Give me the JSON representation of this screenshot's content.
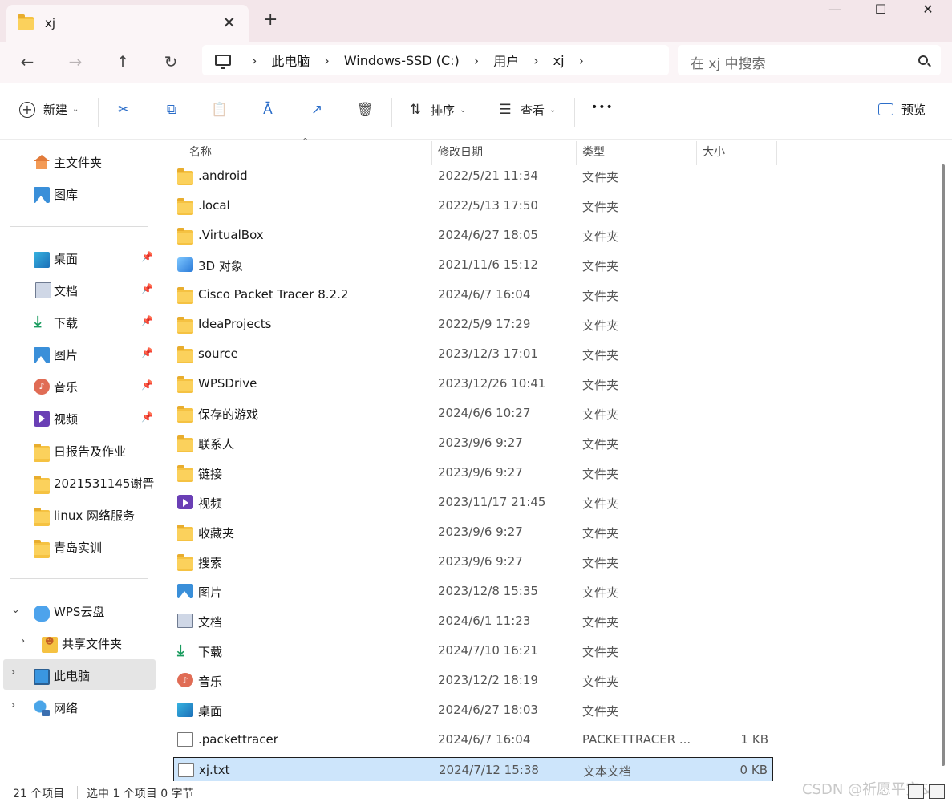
{
  "window": {
    "tab_title": "xj",
    "new_tab_glyph": "+",
    "close_tab_glyph": "✕",
    "minimize_glyph": "—",
    "maximize_glyph": "☐",
    "close_glyph": "✕"
  },
  "nav": {
    "back_glyph": "←",
    "forward_glyph": "→",
    "up_glyph": "↑",
    "refresh_glyph": "↻",
    "breadcrumb": [
      "此电脑",
      "Windows-SSD (C:)",
      "用户",
      "xj"
    ],
    "crumb_sep": "›",
    "search_placeholder": "在 xj 中搜索"
  },
  "toolbar": {
    "new_label": "新建",
    "sort_label": "排序",
    "view_label": "查看",
    "more_glyph": "•••",
    "preview_label": "预览",
    "icons": {
      "cut": "✂",
      "copy": "⧉",
      "paste": "📋",
      "rename": "Ā",
      "share": "↗",
      "delete": "🗑"
    }
  },
  "sidebar": {
    "quick": [
      {
        "label": "主文件夹",
        "icon": "home-icon"
      },
      {
        "label": "图库",
        "icon": "gallery-icon"
      }
    ],
    "pinned": [
      {
        "label": "桌面",
        "icon": "desktop-icon",
        "pinned": true
      },
      {
        "label": "文档",
        "icon": "documents-icon",
        "pinned": true
      },
      {
        "label": "下载",
        "icon": "download-icon",
        "pinned": true
      },
      {
        "label": "图片",
        "icon": "pictures-icon",
        "pinned": true
      },
      {
        "label": "音乐",
        "icon": "music-icon",
        "pinned": true
      },
      {
        "label": "视频",
        "icon": "videos-icon",
        "pinned": true
      },
      {
        "label": "日报告及作业",
        "icon": "folder-icon",
        "pinned": false
      },
      {
        "label": "2021531145谢晋",
        "icon": "folder-icon",
        "pinned": false
      },
      {
        "label": "linux 网络服务",
        "icon": "folder-icon",
        "pinned": false
      },
      {
        "label": "青岛实训",
        "icon": "folder-icon",
        "pinned": false
      }
    ],
    "tree": [
      {
        "label": "WPS云盘",
        "icon": "cloud-icon",
        "expanded": true
      },
      {
        "label": "共享文件夹",
        "icon": "shared-folder-icon"
      },
      {
        "label": "此电脑",
        "icon": "this-pc-icon",
        "selected": true
      },
      {
        "label": "网络",
        "icon": "network-icon"
      }
    ],
    "pin_glyph": "📌"
  },
  "columns": {
    "name": "名称",
    "date": "修改日期",
    "type": "类型",
    "size": "大小"
  },
  "files": [
    {
      "name": ".android",
      "date": "2022/5/21 11:34",
      "type": "文件夹",
      "size": "",
      "icon": "folder"
    },
    {
      "name": ".local",
      "date": "2022/5/13 17:50",
      "type": "文件夹",
      "size": "",
      "icon": "folder"
    },
    {
      "name": ".VirtualBox",
      "date": "2024/6/27 18:05",
      "type": "文件夹",
      "size": "",
      "icon": "folder"
    },
    {
      "name": "3D 对象",
      "date": "2021/11/6 15:12",
      "type": "文件夹",
      "size": "",
      "icon": "cube"
    },
    {
      "name": "Cisco Packet Tracer 8.2.2",
      "date": "2024/6/7 16:04",
      "type": "文件夹",
      "size": "",
      "icon": "folder"
    },
    {
      "name": "IdeaProjects",
      "date": "2022/5/9 17:29",
      "type": "文件夹",
      "size": "",
      "icon": "folder"
    },
    {
      "name": "source",
      "date": "2023/12/3 17:01",
      "type": "文件夹",
      "size": "",
      "icon": "folder"
    },
    {
      "name": "WPSDrive",
      "date": "2023/12/26 10:41",
      "type": "文件夹",
      "size": "",
      "icon": "folder"
    },
    {
      "name": "保存的游戏",
      "date": "2024/6/6 10:27",
      "type": "文件夹",
      "size": "",
      "icon": "folder"
    },
    {
      "name": "联系人",
      "date": "2023/9/6 9:27",
      "type": "文件夹",
      "size": "",
      "icon": "folder"
    },
    {
      "name": "链接",
      "date": "2023/9/6 9:27",
      "type": "文件夹",
      "size": "",
      "icon": "folder"
    },
    {
      "name": "视频",
      "date": "2023/11/17 21:45",
      "type": "文件夹",
      "size": "",
      "icon": "video"
    },
    {
      "name": "收藏夹",
      "date": "2023/9/6 9:27",
      "type": "文件夹",
      "size": "",
      "icon": "folder"
    },
    {
      "name": "搜索",
      "date": "2023/9/6 9:27",
      "type": "文件夹",
      "size": "",
      "icon": "folder"
    },
    {
      "name": "图片",
      "date": "2023/12/8 15:35",
      "type": "文件夹",
      "size": "",
      "icon": "image"
    },
    {
      "name": "文档",
      "date": "2024/6/1 11:23",
      "type": "文件夹",
      "size": "",
      "icon": "doc-blue"
    },
    {
      "name": "下载",
      "date": "2024/7/10 16:21",
      "type": "文件夹",
      "size": "",
      "icon": "download"
    },
    {
      "name": "音乐",
      "date": "2023/12/2 18:19",
      "type": "文件夹",
      "size": "",
      "icon": "music"
    },
    {
      "name": "桌面",
      "date": "2024/6/27 18:03",
      "type": "文件夹",
      "size": "",
      "icon": "desktop"
    },
    {
      "name": ".packettracer",
      "date": "2024/6/7 16:04",
      "type": "PACKETTRACER ...",
      "size": "1 KB",
      "icon": "doc"
    },
    {
      "name": "xj.txt",
      "date": "2024/7/12 15:38",
      "type": "文本文档",
      "size": "0 KB",
      "icon": "doc",
      "selected": true
    }
  ],
  "status": {
    "count": "21 个项目",
    "selection": "选中 1 个项目  0 字节"
  },
  "watermark": "CSDN @祈愿平安&",
  "colors": {
    "titlebar_bg": "#f3e6ea",
    "selection_bg": "#cde5fb",
    "accent": "#2c6ec9",
    "folder": "#f5c242"
  }
}
